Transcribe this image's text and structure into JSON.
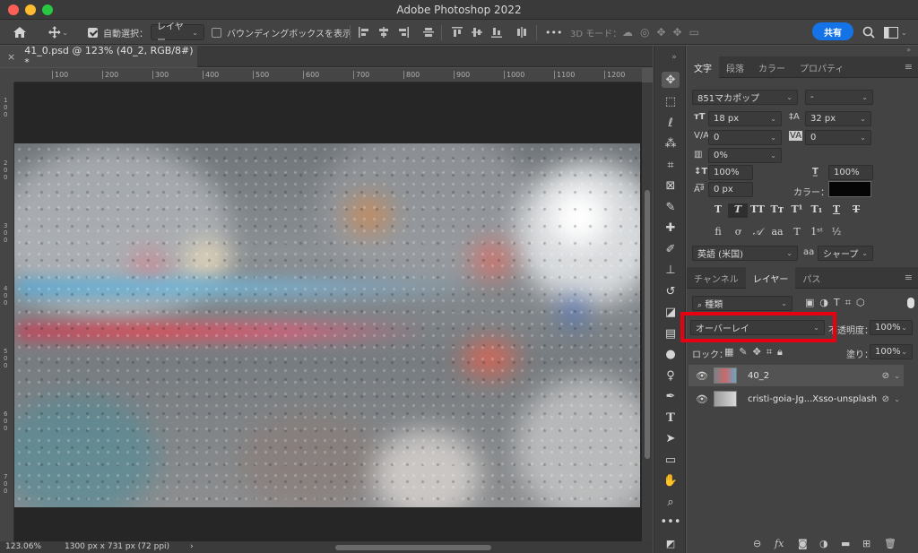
{
  "app": {
    "title": "Adobe Photoshop 2022"
  },
  "options_bar": {
    "auto_select_label": "自動選択：",
    "auto_select_value": "レイヤー",
    "bounding_box_label": "バウンディングボックスを表示",
    "mode_3d_label": "3D モード：",
    "more_label": "•••",
    "share_label": "共有"
  },
  "document": {
    "tab_title": "41_0.psd @ 123% (40_2, RGB/8#) *",
    "close_glyph": "×"
  },
  "rulers": {
    "top_ticks": [
      "100",
      "200",
      "300",
      "400",
      "500",
      "600",
      "700",
      "800",
      "900",
      "1000",
      "1100",
      "1200"
    ],
    "left_ticks": [
      "100",
      "200",
      "300",
      "400",
      "500",
      "600",
      "700"
    ]
  },
  "status": {
    "zoom": "123.06%",
    "doc_size": "1300 px x 731 px (72 ppi)",
    "arrow": "›"
  },
  "character_panel": {
    "tabs": [
      "文字",
      "段落",
      "カラー",
      "プロパティ"
    ],
    "active_tab": 0,
    "font_family": "851マカポップ",
    "font_style": "-",
    "font_size": "18 px",
    "leading": "32 px",
    "kerning": "0",
    "tracking": "0",
    "tsume": "0%",
    "vertical_scale": "100%",
    "horizontal_scale": "100%",
    "baseline_shift": "0 px",
    "color_label": "カラー：",
    "text_color": "#050505",
    "language": "英語 (米国)",
    "aa_label": "aa",
    "antialias": "シャープ"
  },
  "layers_panel": {
    "tabs": [
      "チャンネル",
      "レイヤー",
      "パス"
    ],
    "active_tab": 1,
    "filter_kind": "種類",
    "blend_mode": "オーバーレイ",
    "opacity_label": "不透明度：",
    "opacity": "100%",
    "lock_label": "ロック：",
    "fill_label": "塗り：",
    "fill": "100%",
    "layers": [
      {
        "name": "40_2",
        "selected": true
      },
      {
        "name": "cristi-goia-Jg...Xsso-unsplash",
        "selected": false
      }
    ]
  },
  "colors": {
    "accent": "#1473e6",
    "highlight_box": "#e60012"
  }
}
